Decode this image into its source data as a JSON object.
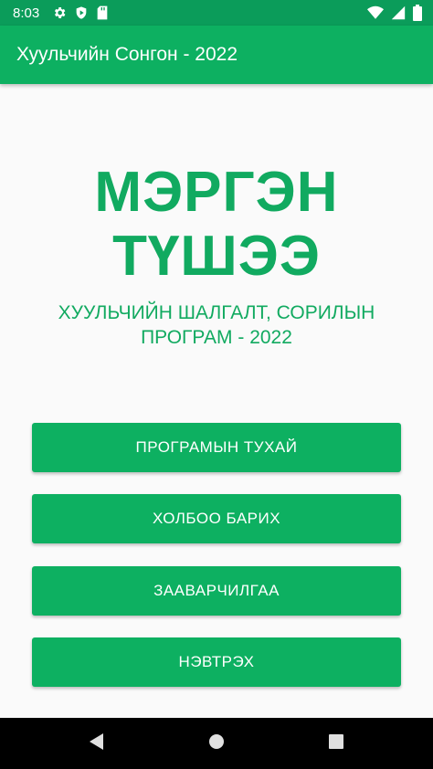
{
  "status_bar": {
    "time": "8:03",
    "left_icons": [
      "settings-icon",
      "play-protect-icon",
      "sd-card-icon"
    ],
    "right_icons": [
      "wifi-icon",
      "signal-icon",
      "battery-icon"
    ]
  },
  "app_bar": {
    "title": "Хуульчийн Сонгон - 2022"
  },
  "hero": {
    "title_line1": "МЭРГЭН",
    "title_line2": "ТҮШЭЭ",
    "subtitle_line1": "ХУУЛЬЧИЙН ШАЛГАЛТ, СОРИЛЫН",
    "subtitle_line2": "ПРОГРАМ - 2022"
  },
  "menu": {
    "buttons": [
      {
        "label": "ПРОГРАМЫН ТУХАЙ"
      },
      {
        "label": "ХОЛБОО БАРИХ"
      },
      {
        "label": "ЗААВАРЧИЛГАА"
      },
      {
        "label": "НЭВТРЭХ"
      }
    ]
  },
  "nav_bar": {
    "icons": [
      "back-icon",
      "home-icon",
      "recents-icon"
    ]
  },
  "colors": {
    "status_bar": "#0b9c5a",
    "primary": "#0db061",
    "text_accent": "#11aa60",
    "background": "#fafafa"
  }
}
